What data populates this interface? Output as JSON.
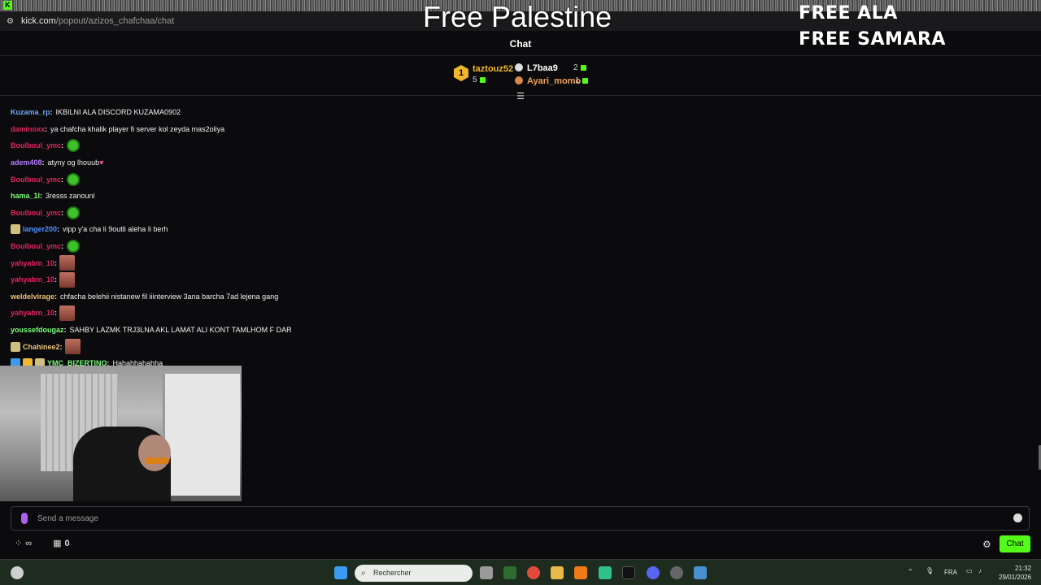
{
  "browser": {
    "url_host": "kick.com",
    "url_path": "/popout/azizos_chafchaa/chat",
    "favicon": "K"
  },
  "overlay": {
    "free_palestine": "Free Palestine",
    "free_ala": "FREE ALA",
    "free_samara": "FREE SAMARA"
  },
  "chat": {
    "header": "Chat"
  },
  "leaderboard": {
    "first": {
      "rank": "1",
      "name": "taztouz52",
      "count": "5"
    },
    "second": {
      "name": "L7baa9",
      "count": "2"
    },
    "third": {
      "name": "Ayari_momo",
      "count": "1"
    }
  },
  "messages": [
    {
      "user": "Kuzama_rp",
      "color": "#6ea8ff",
      "text": "IKBILNI ALA DISCORD KUZAMA0902"
    },
    {
      "user": "daminoxx",
      "color": "#e0245e",
      "text": "ya chafcha khalik player fi server kol zeyda mas2oliya"
    },
    {
      "user": "Boulboul_ymc",
      "color": "#e0245e",
      "text": "",
      "emote": "green"
    },
    {
      "user": "adem408",
      "color": "#b57cff",
      "text": "atyny og lhouub",
      "heart": true
    },
    {
      "user": "Boulboul_ymc",
      "color": "#e0245e",
      "text": "",
      "emote": "green"
    },
    {
      "user": "hama_1l",
      "color": "#7cff7c",
      "text": "3resss zanouni"
    },
    {
      "user": "Boulboul_ymc",
      "color": "#e0245e",
      "text": "",
      "emote": "green"
    },
    {
      "user": "langer200",
      "color": "#4f8fff",
      "text": "vipp y'a cha li 9outli aleha li berh",
      "badge": true
    },
    {
      "user": "Boulboul_ymc",
      "color": "#e0245e",
      "text": "",
      "emote": "green"
    },
    {
      "user": "yahyabm_10",
      "color": "#e0245e",
      "text": "",
      "emote": "face"
    },
    {
      "user": "yahyabm_10",
      "color": "#e0245e",
      "text": "",
      "emote": "face"
    },
    {
      "user": "weldelvirage",
      "color": "#f0c27a",
      "text": "chfacha belehii nistanew fil iiinterview 3ana barcha 7ad lejena gang"
    },
    {
      "user": "yahyabm_10",
      "color": "#e0245e",
      "text": "",
      "emote": "face"
    },
    {
      "user": "youssefdougaz",
      "color": "#7cff7c",
      "text": "SAHBY LAZMK TRJ3LNA AKL LAMAT ALI KONT TAMLHOM F DAR"
    },
    {
      "user": "Chahinee2",
      "color": "#f0c27a",
      "text": "",
      "emote": "face",
      "badge": true
    },
    {
      "user": "YMC_BIZERTINO",
      "color": "#7cff7c",
      "text": "Hahahhahahha",
      "badges3": true
    }
  ],
  "input": {
    "placeholder": "Send a message"
  },
  "footer": {
    "infinity": "∞",
    "store_count": "0",
    "chat_button": "Chat"
  },
  "taskbar": {
    "search_placeholder": "Rechercher",
    "lang": "FRA",
    "time": "21:32",
    "date": "29/01/2026"
  },
  "colors": {
    "accent": "#53fc18",
    "gold": "#f2b72c"
  }
}
